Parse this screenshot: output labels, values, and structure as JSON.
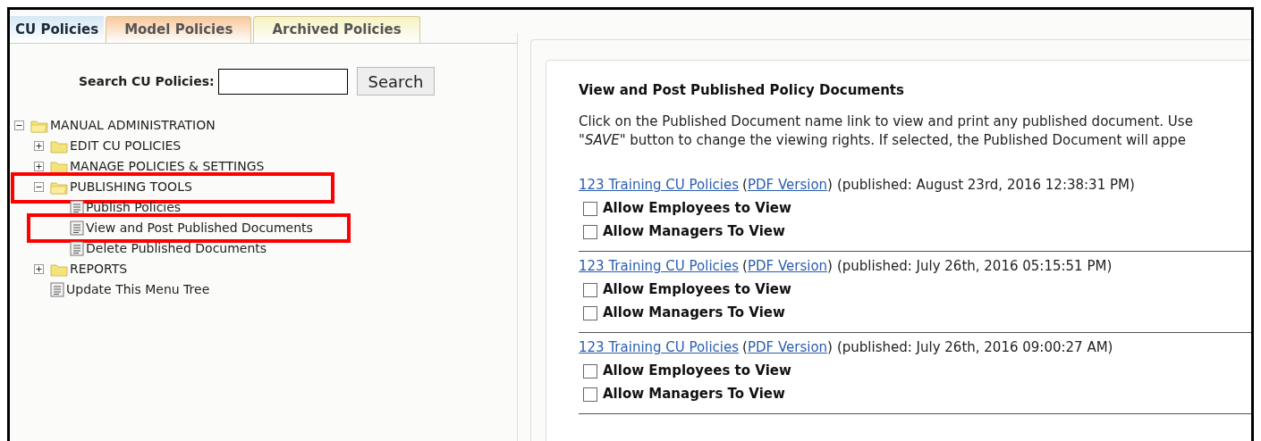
{
  "tabs": [
    {
      "label": "CU Policies",
      "selected": true,
      "color": "#d6e8f5"
    },
    {
      "label": "Model Policies",
      "selected": false,
      "color": "#f8c89a"
    },
    {
      "label": "Archived Policies",
      "selected": false,
      "color": "#f6f3c0"
    }
  ],
  "search": {
    "label": "Search CU Policies:",
    "button": "Search"
  },
  "tree": [
    {
      "label": "MANUAL ADMINISTRATION",
      "kind": "folder",
      "expanded": true,
      "highlighted": false,
      "children": [
        {
          "label": "EDIT CU POLICIES",
          "kind": "folder",
          "expanded": false,
          "highlighted": false
        },
        {
          "label": "MANAGE POLICIES & SETTINGS",
          "kind": "folder",
          "expanded": false,
          "highlighted": false
        },
        {
          "label": "PUBLISHING TOOLS",
          "kind": "folder",
          "expanded": true,
          "highlighted": true,
          "children": [
            {
              "label": "Publish Policies",
              "kind": "page",
              "highlighted": false
            },
            {
              "label": "View and Post Published Documents",
              "kind": "page",
              "highlighted": true
            },
            {
              "label": "Delete Published Documents",
              "kind": "page",
              "highlighted": false
            }
          ]
        },
        {
          "label": "REPORTS",
          "kind": "folder",
          "expanded": false,
          "highlighted": false
        },
        {
          "label": "Update This Menu Tree",
          "kind": "page",
          "highlighted": false
        }
      ]
    }
  ],
  "panel": {
    "title": "View and Post Published Policy Documents",
    "intro_lines": [
      "Click on the Published Document name link to view and print any published document. Use",
      "*\"SAVE\"* button to change the viewing rights. If selected, the Published Document will appe"
    ],
    "documents": [
      {
        "name": "123 Training CU Policies",
        "open_paren": "(",
        "pdf_link": "PDF Version",
        "close_paren": ")",
        "published": "(published: August 23rd, 2016 12:38:31 PM)",
        "options": [
          {
            "label": "Allow Employees to View",
            "checked": false
          },
          {
            "label": "Allow Managers To View",
            "checked": false
          }
        ]
      },
      {
        "name": "123 Training CU Policies",
        "open_paren": "(",
        "pdf_link": "PDF Version",
        "close_paren": ")",
        "published": "(published: July 26th, 2016 05:15:51 PM)",
        "options": [
          {
            "label": "Allow Employees to View",
            "checked": false
          },
          {
            "label": "Allow Managers To View",
            "checked": false
          }
        ]
      },
      {
        "name": "123 Training CU Policies",
        "open_paren": "(",
        "pdf_link": "PDF Version",
        "close_paren": ")",
        "published": "(published: July 26th, 2016 09:00:27 AM)",
        "options": [
          {
            "label": "Allow Employees to View",
            "checked": false
          },
          {
            "label": "Allow Managers To View",
            "checked": false
          }
        ]
      }
    ]
  }
}
